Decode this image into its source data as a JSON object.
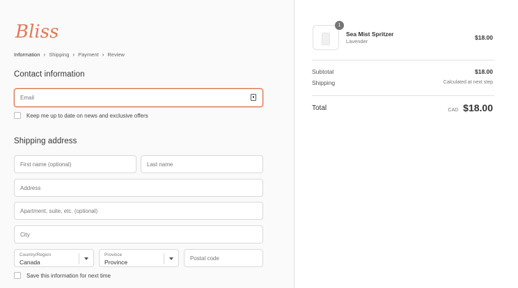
{
  "brand": {
    "logo_text": "Bliss",
    "accent_color": "#d96a3c"
  },
  "breadcrumb": [
    "Information",
    "Shipping",
    "Payment",
    "Review"
  ],
  "contact": {
    "title": "Contact information",
    "email_placeholder": "Email",
    "newsletter_label": "Keep me up to date on news and exclusive offers"
  },
  "shipping": {
    "title": "Shipping address",
    "first_name_placeholder": "First name (optional)",
    "last_name_placeholder": "Last name",
    "address_placeholder": "Address",
    "apartment_placeholder": "Apartment, suite, etc. (optional)",
    "city_placeholder": "City",
    "country_label": "Country/Region",
    "country_value": "Canada",
    "province_label": "Province",
    "province_value": "Province",
    "postal_placeholder": "Postal code",
    "save_info_label": "Save this information for next time"
  },
  "order": {
    "item": {
      "quantity": "1",
      "name": "Sea Mist Spritzer",
      "variant": "Lavender",
      "price": "$18.00"
    },
    "subtotal_label": "Subtotal",
    "subtotal_value": "$18.00",
    "shipping_label": "Shipping",
    "shipping_value": "Calculated at next step",
    "total_label": "Total",
    "currency": "CAD",
    "total_value": "$18.00"
  },
  "icons": {
    "email_field": "contact-card-icon",
    "select": "chevron-down-icon"
  }
}
